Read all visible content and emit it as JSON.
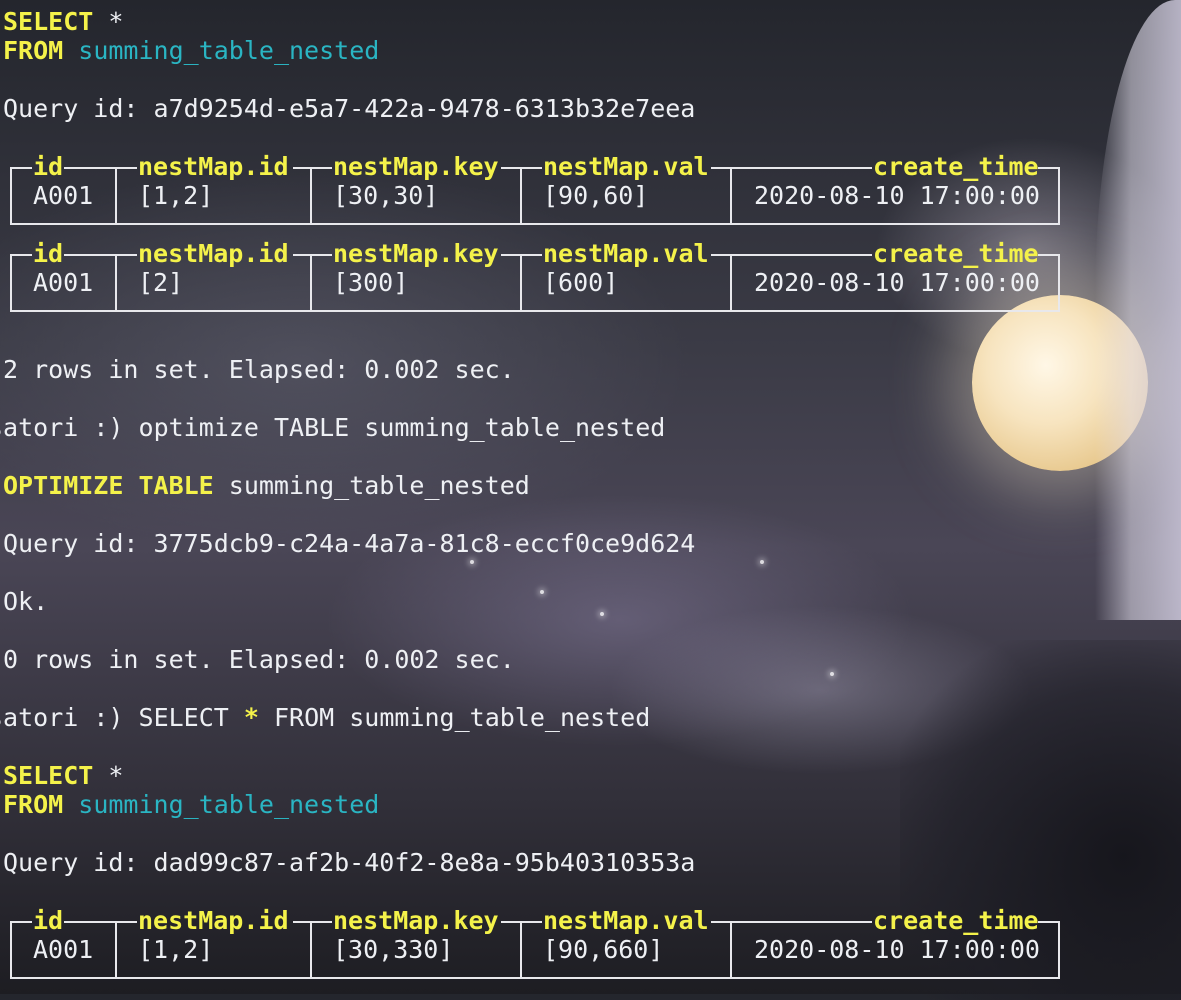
{
  "first_query": {
    "keyword_select": "SELECT",
    "select_star": "*",
    "keyword_from": "FROM",
    "table": "summing_table_nested",
    "query_id": "Query id: a7d9254d-e5a7-422a-9478-6313b32e7eea"
  },
  "columns": [
    "id",
    "nestMap.id",
    "nestMap.key",
    "nestMap.val",
    "create_time"
  ],
  "result_1": [
    {
      "id": "A001",
      "nest_id": "[1,2]",
      "nest_key": "[30,30]",
      "nest_val": "[90,60]",
      "create_time": "2020-08-10 17:00:00"
    },
    {
      "id": "A001",
      "nest_id": "[2]",
      "nest_key": "[300]",
      "nest_val": "[600]",
      "create_time": "2020-08-10 17:00:00"
    }
  ],
  "status_1": "2 rows in set. Elapsed: 0.002 sec.",
  "optimize": {
    "prompt": "satori :) optimize TABLE summing_table_nested",
    "keyword": "OPTIMIZE TABLE",
    "table": "summing_table_nested",
    "query_id": "Query id: 3775dcb9-c24a-4a7a-81c8-eccf0ce9d624",
    "ok": "Ok.",
    "status": "0 rows in set. Elapsed: 0.002 sec."
  },
  "second_query": {
    "prompt_prefix": "satori :) SELECT ",
    "prompt_star": "*",
    "prompt_suffix": " FROM summing_table_nested",
    "keyword_select": "SELECT",
    "select_star": "*",
    "keyword_from": "FROM",
    "table": "summing_table_nested",
    "query_id": "Query id: dad99c87-af2b-40f2-8e8a-95b40310353a"
  },
  "result_2": [
    {
      "id": "A001",
      "nest_id": "[1,2]",
      "nest_key": "[30,330]",
      "nest_val": "[90,660]",
      "create_time": "2020-08-10 17:00:00"
    }
  ],
  "colors": {
    "keyword": "#f4f24a",
    "identifier": "#2ab5c3",
    "text": "#eef0f4"
  }
}
